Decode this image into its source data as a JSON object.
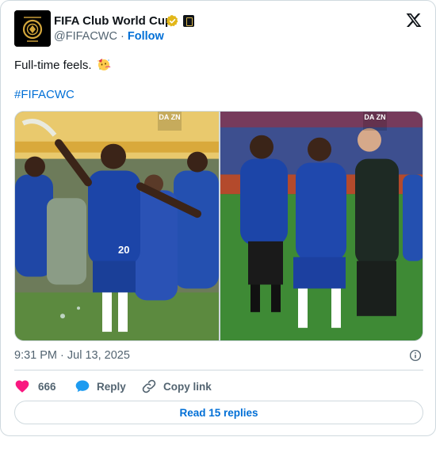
{
  "author": {
    "name": "FIFA Club World Cup",
    "handle": "@FIFACWC",
    "separator": "·",
    "follow_label": "Follow",
    "avatar_text": "FIFA WORLD CUP"
  },
  "tweet": {
    "text": "Full-time feels.",
    "hashtag": "#FIFACWC",
    "timestamp": "9:31 PM · Jul 13, 2025"
  },
  "media": {
    "watermark_left": "DA ZN",
    "watermark_right": "DA ZN"
  },
  "actions": {
    "like_count": "666",
    "reply_label": "Reply",
    "copy_label": "Copy link"
  },
  "read_replies_label": "Read 15 replies",
  "icons": {
    "verified": "verified-gold-badge-icon",
    "affiliate": "affiliate-badge-icon",
    "logo": "x-logo-icon",
    "emoji": "partying-face-emoji",
    "info": "info-icon",
    "like": "heart-icon",
    "reply": "speech-bubble-icon",
    "copy": "link-icon"
  },
  "colors": {
    "link": "#006fd6",
    "like": "#f91880",
    "reply": "#1d9bf0",
    "muted": "#536471",
    "verified_gold": "#e2b719",
    "chelsea_blue": "#1c45a8"
  }
}
